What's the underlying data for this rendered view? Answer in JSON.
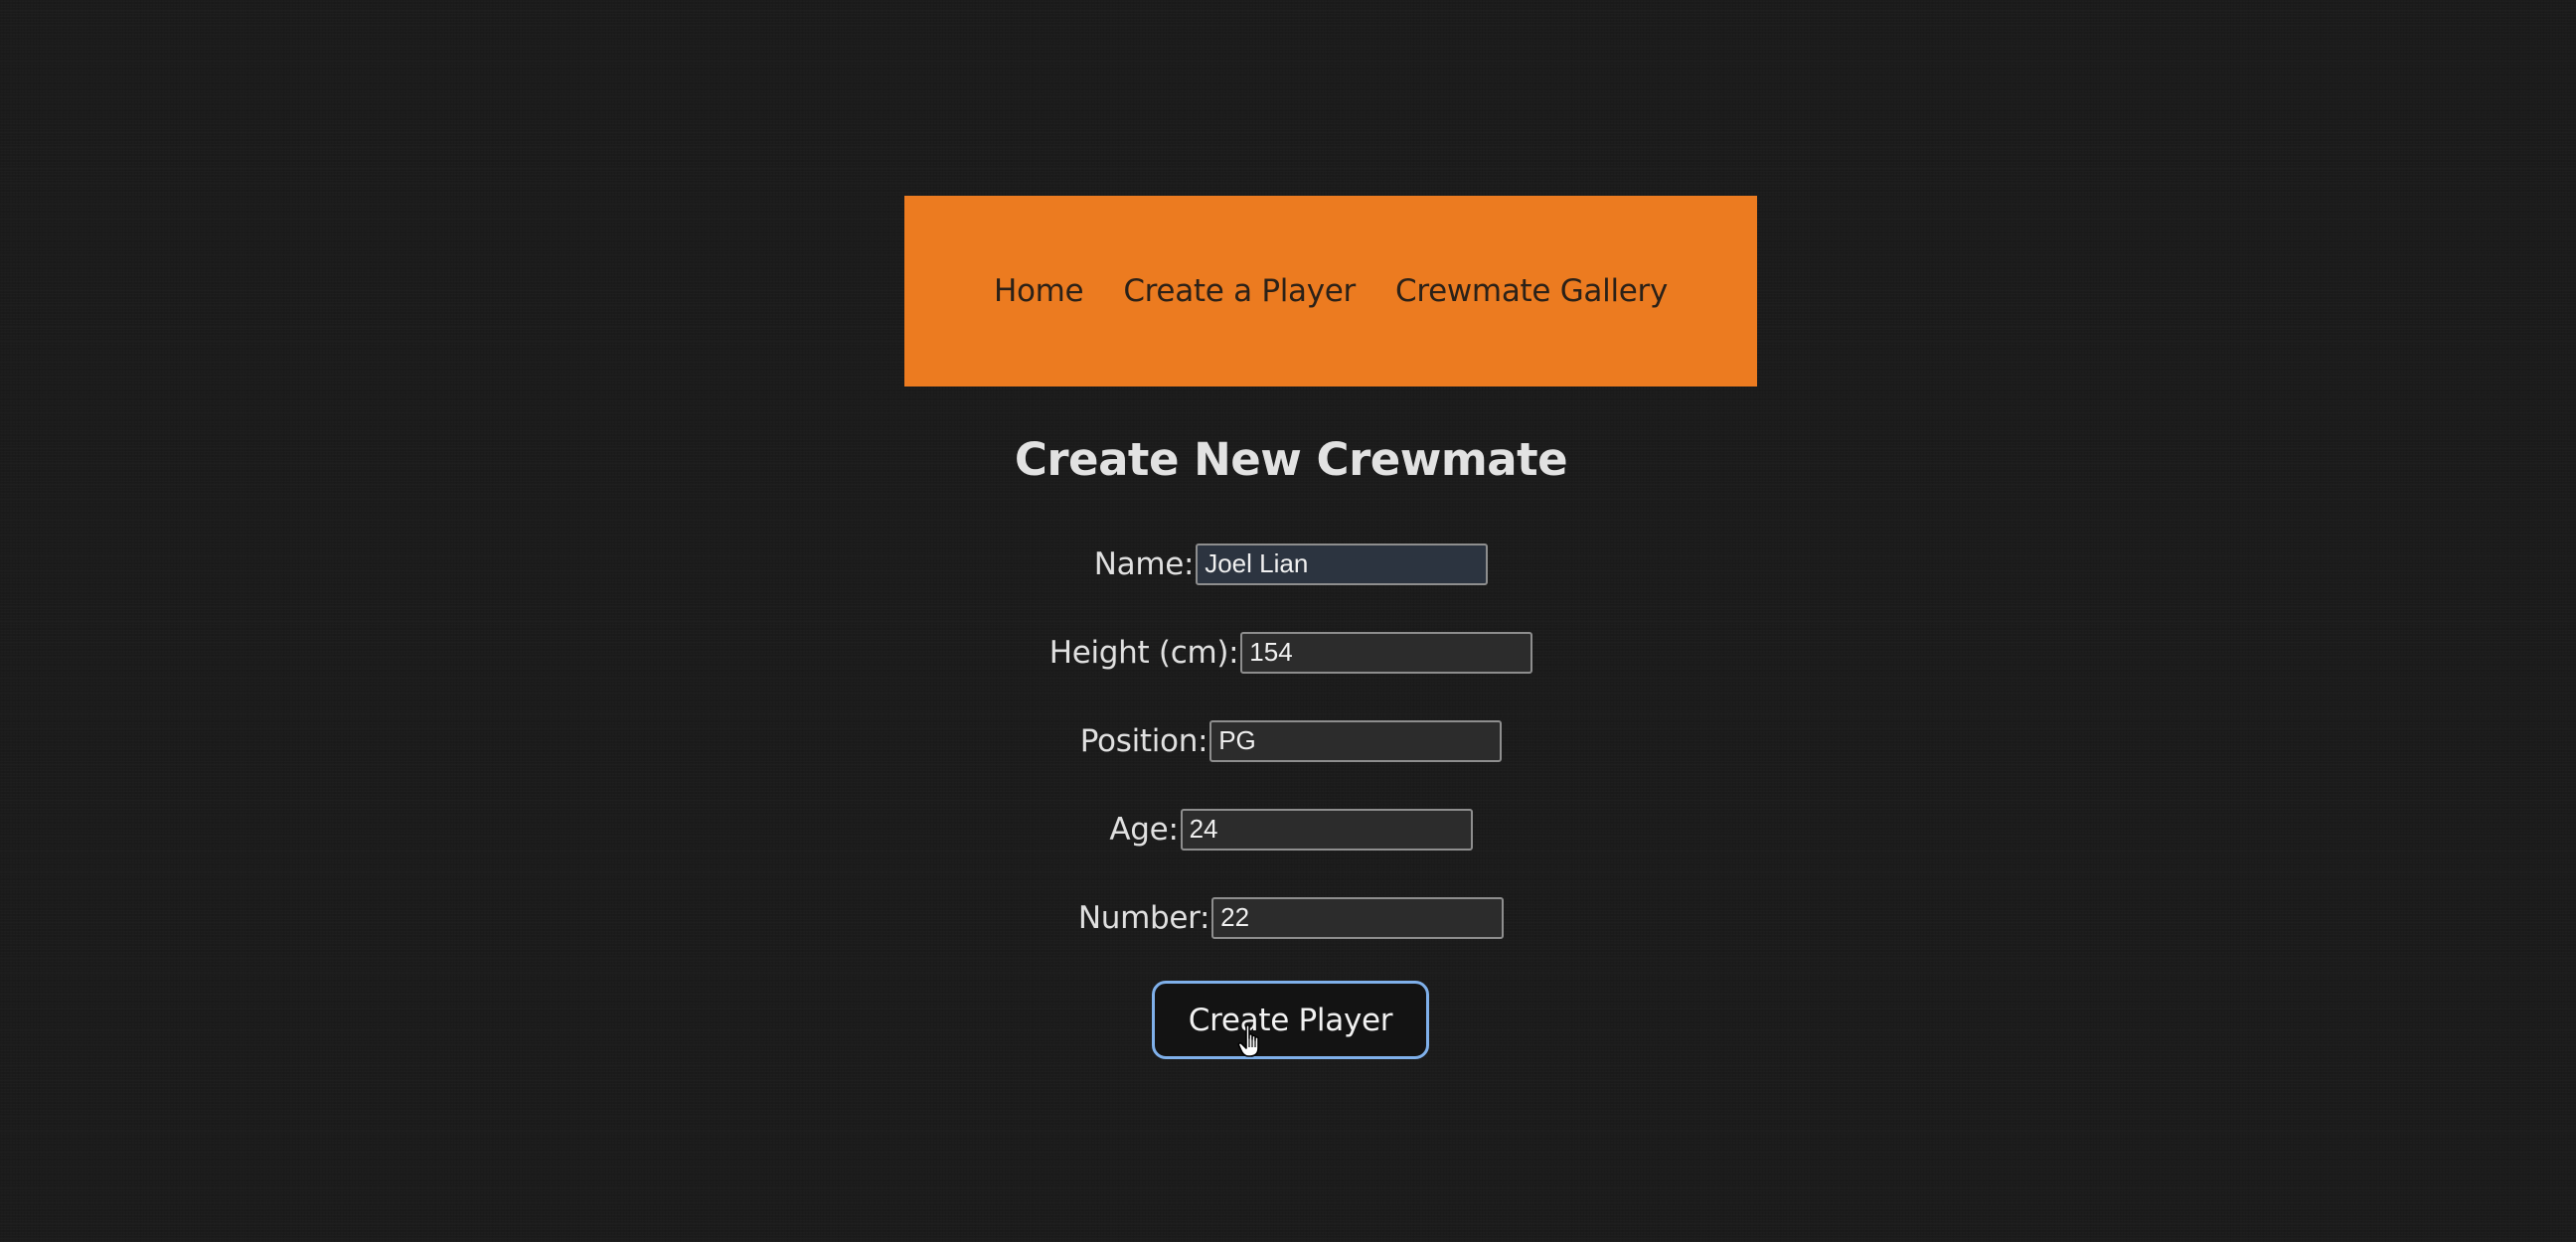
{
  "nav": {
    "links": [
      {
        "label": "Home"
      },
      {
        "label": "Create a Player"
      },
      {
        "label": "Crewmate Gallery"
      }
    ],
    "background_color": "#ec7b20"
  },
  "page": {
    "title": "Create New Crewmate"
  },
  "form": {
    "fields": [
      {
        "label": "Name:",
        "value": "Joel Lian"
      },
      {
        "label": "Height (cm):",
        "value": "154"
      },
      {
        "label": "Position:",
        "value": "PG"
      },
      {
        "label": "Age:",
        "value": "24"
      },
      {
        "label": "Number:",
        "value": "22"
      }
    ],
    "submit_label": "Create Player"
  },
  "colors": {
    "background": "#1b1b1b",
    "accent": "#ec7b20",
    "button_focus_ring": "#7fb0ea"
  },
  "icons": {
    "cursor": "hand-pointer-icon"
  }
}
